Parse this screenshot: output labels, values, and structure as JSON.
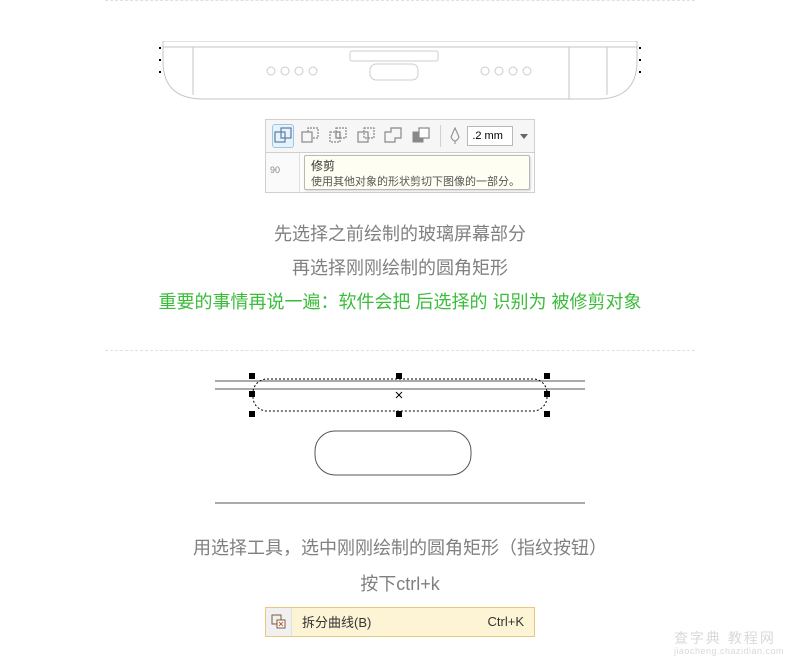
{
  "toolbar": {
    "stroke_width": ".2 mm"
  },
  "tooltip": {
    "title": "修剪",
    "desc": "使用其他对象的形状剪切下图像的一部分。"
  },
  "ruler": {
    "tick": "90"
  },
  "section1": {
    "line1": "先选择之前绘制的玻璃屏幕部分",
    "line2": "再选择刚刚绘制的圆角矩形",
    "line3": "重要的事情再说一遍：软件会把 后选择的 识别为 被修剪对象"
  },
  "section2": {
    "line1": "用选择工具，选中刚刚绘制的圆角矩形（指纹按钮）",
    "line2": "按下ctrl+k"
  },
  "menuitem": {
    "label": "拆分曲线(B)",
    "shortcut": "Ctrl+K"
  },
  "watermark": {
    "text": "查字典 教程网",
    "sub": "jiaocheng.chazidian.com"
  }
}
